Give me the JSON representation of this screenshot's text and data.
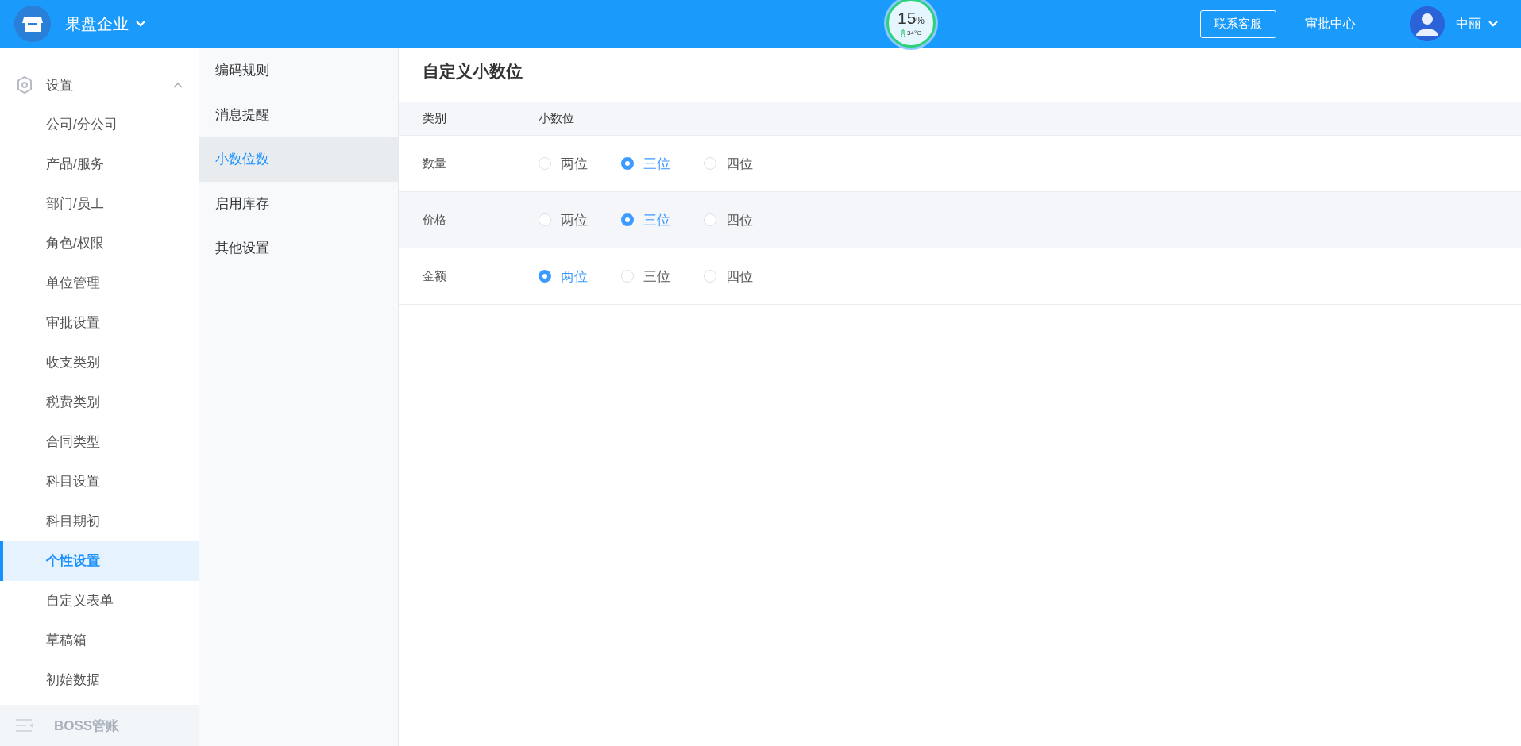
{
  "topbar": {
    "company": "果盘企业",
    "gauge": {
      "value": "15",
      "unit": "%",
      "temperature": "34°C"
    },
    "support_button": "联系客服",
    "approval_link": "审批中心",
    "user": "中丽"
  },
  "sidebar": {
    "groups": [
      {
        "label": "设置",
        "kind": "settings",
        "expanded": true,
        "disabled": false,
        "items": [
          {
            "label": "公司/分公司",
            "selected": false
          },
          {
            "label": "产品/服务",
            "selected": false
          },
          {
            "label": "部门/员工",
            "selected": false
          },
          {
            "label": "角色/权限",
            "selected": false
          },
          {
            "label": "单位管理",
            "selected": false
          },
          {
            "label": "审批设置",
            "selected": false
          },
          {
            "label": "收支类别",
            "selected": false
          },
          {
            "label": "税费类别",
            "selected": false
          },
          {
            "label": "合同类型",
            "selected": false
          },
          {
            "label": "科目设置",
            "selected": false
          },
          {
            "label": "科目期初",
            "selected": false
          },
          {
            "label": "个性设置",
            "selected": true
          },
          {
            "label": "自定义表单",
            "selected": false
          },
          {
            "label": "草稿箱",
            "selected": false
          },
          {
            "label": "初始数据",
            "selected": false
          }
        ]
      },
      {
        "label": "BOSS管账",
        "kind": "boss",
        "expanded": false,
        "disabled": true
      }
    ]
  },
  "submenu": [
    {
      "label": "编码规则",
      "selected": false
    },
    {
      "label": "消息提醒",
      "selected": false
    },
    {
      "label": "小数位数",
      "selected": true
    },
    {
      "label": "启用库存",
      "selected": false
    },
    {
      "label": "其他设置",
      "selected": false
    }
  ],
  "main": {
    "title": "自定义小数位",
    "columns": [
      "类别",
      "小数位"
    ],
    "rows": [
      {
        "category": "数量",
        "options": [
          {
            "label": "两位",
            "selected": false
          },
          {
            "label": "三位",
            "selected": true
          },
          {
            "label": "四位",
            "selected": false
          }
        ]
      },
      {
        "category": "价格",
        "options": [
          {
            "label": "两位",
            "selected": false
          },
          {
            "label": "三位",
            "selected": true
          },
          {
            "label": "四位",
            "selected": false
          }
        ]
      },
      {
        "category": "金额",
        "options": [
          {
            "label": "两位",
            "selected": true
          },
          {
            "label": "三位",
            "selected": false
          },
          {
            "label": "四位",
            "selected": false
          }
        ]
      }
    ]
  }
}
